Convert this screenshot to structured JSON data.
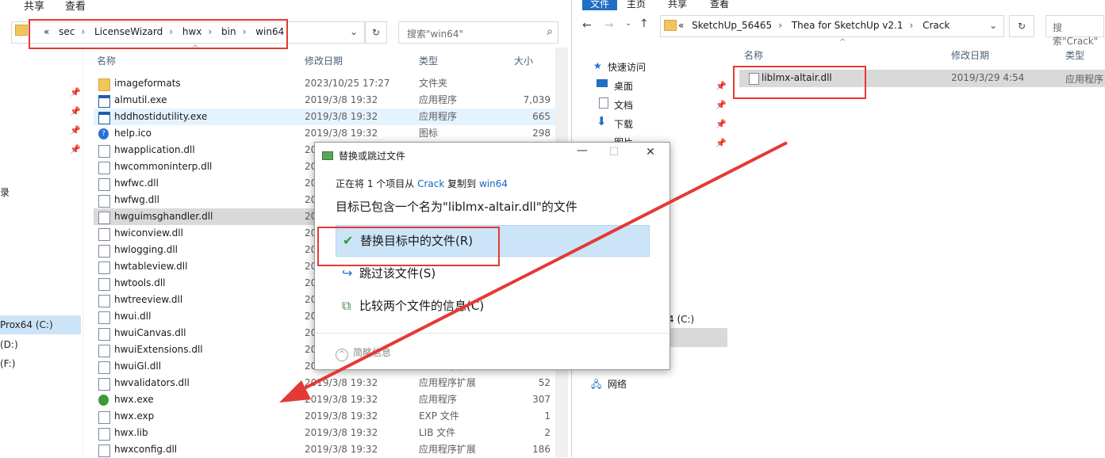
{
  "left_window": {
    "ribbon_tabs": [
      "共享",
      "查看"
    ],
    "breadcrumb": [
      "«",
      "sec",
      "LicenseWizard",
      "hwx",
      "bin",
      "win64"
    ],
    "search_placeholder": "搜索\"win64\"",
    "columns": {
      "name": "名称",
      "date": "修改日期",
      "type": "类型",
      "size": "大小"
    },
    "nav": [
      {
        "label": "Prox64 (C:)"
      },
      {
        "label": "(D:)"
      },
      {
        "label": "(F:)"
      },
      {
        "label": "录"
      }
    ],
    "files": [
      {
        "name": "imageformats",
        "date": "2023/10/25 17:27",
        "type": "文件夹",
        "size": "",
        "icon": "folder-icon"
      },
      {
        "name": "almutil.exe",
        "date": "2019/3/8 19:32",
        "type": "应用程序",
        "size": "7,039",
        "icon": "exe-icon"
      },
      {
        "name": "hddhostidutility.exe",
        "date": "2019/3/8 19:32",
        "type": "应用程序",
        "size": "665",
        "icon": "exe-icon"
      },
      {
        "name": "help.ico",
        "date": "2019/3/8 19:32",
        "type": "图标",
        "size": "298",
        "icon": "help-icon"
      },
      {
        "name": "hwapplication.dll",
        "date": "20",
        "type": "",
        "size": "",
        "icon": "dll-icon"
      },
      {
        "name": "hwcommoninterp.dll",
        "date": "20",
        "type": "",
        "size": "",
        "icon": "dll-icon"
      },
      {
        "name": "hwfwc.dll",
        "date": "20",
        "type": "",
        "size": "",
        "icon": "dll-icon"
      },
      {
        "name": "hwfwg.dll",
        "date": "20",
        "type": "",
        "size": "",
        "icon": "dll-icon"
      },
      {
        "name": "hwguimsghandler.dll",
        "date": "20",
        "type": "",
        "size": "",
        "icon": "dll-icon"
      },
      {
        "name": "hwiconview.dll",
        "date": "20",
        "type": "",
        "size": "",
        "icon": "dll-icon"
      },
      {
        "name": "hwlogging.dll",
        "date": "20",
        "type": "",
        "size": "",
        "icon": "dll-icon"
      },
      {
        "name": "hwtableview.dll",
        "date": "20",
        "type": "",
        "size": "",
        "icon": "dll-icon"
      },
      {
        "name": "hwtools.dll",
        "date": "20",
        "type": "",
        "size": "",
        "icon": "dll-icon"
      },
      {
        "name": "hwtreeview.dll",
        "date": "20",
        "type": "",
        "size": "",
        "icon": "dll-icon"
      },
      {
        "name": "hwui.dll",
        "date": "20",
        "type": "",
        "size": "",
        "icon": "dll-icon"
      },
      {
        "name": "hwuiCanvas.dll",
        "date": "20",
        "type": "",
        "size": "",
        "icon": "dll-icon"
      },
      {
        "name": "hwuiExtensions.dll",
        "date": "20",
        "type": "",
        "size": "",
        "icon": "dll-icon"
      },
      {
        "name": "hwuiGl.dll",
        "date": "20",
        "type": "应用程序扩展",
        "size": "",
        "icon": "dll-icon"
      },
      {
        "name": "hwvalidators.dll",
        "date": "2019/3/8 19:32",
        "type": "应用程序扩展",
        "size": "52",
        "icon": "dll-icon"
      },
      {
        "name": "hwx.exe",
        "date": "2019/3/8 19:32",
        "type": "应用程序",
        "size": "307",
        "icon": "hwx-icon"
      },
      {
        "name": "hwx.exp",
        "date": "2019/3/8 19:32",
        "type": "EXP 文件",
        "size": "1",
        "icon": "file-icon"
      },
      {
        "name": "hwx.lib",
        "date": "2019/3/8 19:32",
        "type": "LIB 文件",
        "size": "2",
        "icon": "file-icon"
      },
      {
        "name": "hwxconfig.dll",
        "date": "2019/3/8 19:32",
        "type": "应用程序扩展",
        "size": "186",
        "icon": "dll-icon"
      }
    ]
  },
  "right_window": {
    "ribbon_tabs": [
      "文件",
      "主页",
      "共享",
      "查看"
    ],
    "breadcrumb": [
      "«",
      "SketchUp_56465",
      "Thea for SketchUp v2.1",
      "Crack"
    ],
    "search_placeholder": "搜索\"Crack\"",
    "columns": {
      "name": "名称",
      "date": "修改日期",
      "type": "类型"
    },
    "nav": [
      "快速访问",
      "桌面",
      "文档",
      "下载",
      "图片",
      "4 (C:)",
      "网络"
    ],
    "files": [
      {
        "name": "liblmx-altair.dll",
        "date": "2019/3/29 4:54",
        "type": "应用程序"
      }
    ]
  },
  "dialog": {
    "title": "替换或跳过文件",
    "line1_prefix": "正在将 1 个项目从",
    "line1_src": "Crack",
    "line1_mid": "复制到",
    "line1_dst": "win64",
    "line2": "目标已包含一个名为\"liblmx-altair.dll\"的文件",
    "options": [
      {
        "label": "替换目标中的文件(R)",
        "glyph": "✔"
      },
      {
        "label": "跳过该文件(S)",
        "glyph": "↪"
      },
      {
        "label": "比较两个文件的信息(C)",
        "glyph": "⧉"
      }
    ],
    "more_label": "简略信息"
  },
  "colors": {
    "highlight": "#e53935",
    "accent": "#1565c0",
    "selection": "#cce4f7"
  }
}
